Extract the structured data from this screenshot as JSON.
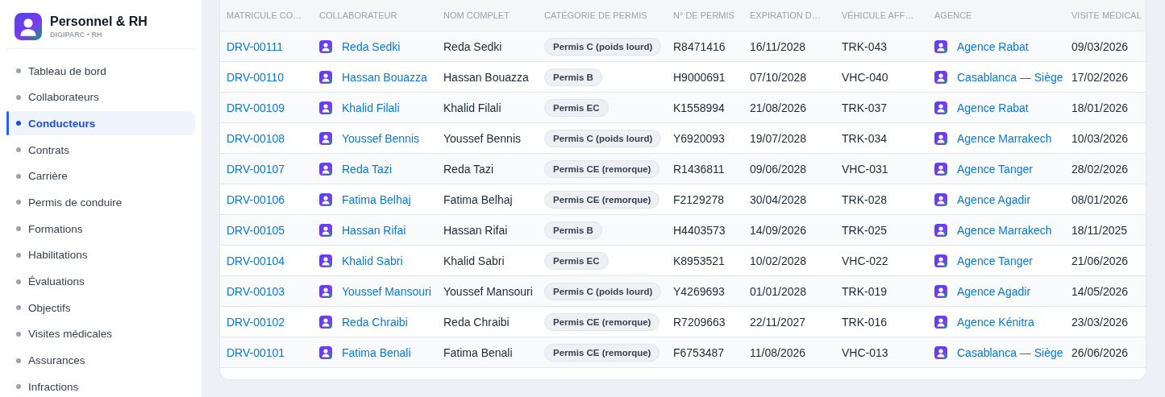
{
  "sidebar": {
    "title": "Personnel & RH",
    "subtitle": "DIGIPARC • RH",
    "items": [
      {
        "label": "Tableau de bord",
        "selected": false
      },
      {
        "label": "Collaborateurs",
        "selected": false
      },
      {
        "label": "Conducteurs",
        "selected": true
      },
      {
        "label": "Contrats",
        "selected": false
      },
      {
        "label": "Carrière",
        "selected": false
      },
      {
        "label": "Permis de conduire",
        "selected": false
      },
      {
        "label": "Formations",
        "selected": false
      },
      {
        "label": "Habilitations",
        "selected": false
      },
      {
        "label": "Évaluations",
        "selected": false
      },
      {
        "label": "Objectifs",
        "selected": false
      },
      {
        "label": "Visites médicales",
        "selected": false
      },
      {
        "label": "Assurances",
        "selected": false
      },
      {
        "label": "Infractions",
        "selected": false
      }
    ]
  },
  "table": {
    "columns": [
      "MATRICULE CO…",
      "COLLABORATEUR",
      "NOM COMPLET",
      "CATÉGORIE DE PERMIS",
      "N° DE PERMIS",
      "EXPIRATION D…",
      "VÉHICULE AFF…",
      "AGENCE",
      "VISITE MÉDICAL"
    ],
    "rows": [
      {
        "matricule": "DRV-00111",
        "collaborateur": "Reda Sedki",
        "nom_complet": "Reda Sedki",
        "categorie": "Permis C (poids lourd)",
        "numero_permis": "R8471416",
        "expiration": "16/11/2028",
        "vehicule": "TRK-043",
        "agence": "Agence Rabat",
        "visite_medicale": "09/03/2026"
      },
      {
        "matricule": "DRV-00110",
        "collaborateur": "Hassan Bouazza",
        "nom_complet": "Hassan Bouazza",
        "categorie": "Permis B",
        "numero_permis": "H9000691",
        "expiration": "07/10/2028",
        "vehicule": "VHC-040",
        "agence": "Casablanca — Siège",
        "visite_medicale": "17/02/2026"
      },
      {
        "matricule": "DRV-00109",
        "collaborateur": "Khalid Filali",
        "nom_complet": "Khalid Filali",
        "categorie": "Permis EC",
        "numero_permis": "K1558994",
        "expiration": "21/08/2026",
        "vehicule": "TRK-037",
        "agence": "Agence Rabat",
        "visite_medicale": "18/01/2026"
      },
      {
        "matricule": "DRV-00108",
        "collaborateur": "Youssef Bennis",
        "nom_complet": "Youssef Bennis",
        "categorie": "Permis C (poids lourd)",
        "numero_permis": "Y6920093",
        "expiration": "19/07/2028",
        "vehicule": "TRK-034",
        "agence": "Agence Marrakech",
        "visite_medicale": "10/03/2026"
      },
      {
        "matricule": "DRV-00107",
        "collaborateur": "Reda Tazi",
        "nom_complet": "Reda Tazi",
        "categorie": "Permis CE (remorque)",
        "numero_permis": "R1436811",
        "expiration": "09/06/2028",
        "vehicule": "VHC-031",
        "agence": "Agence Tanger",
        "visite_medicale": "28/02/2026"
      },
      {
        "matricule": "DRV-00106",
        "collaborateur": "Fatima Belhaj",
        "nom_complet": "Fatima Belhaj",
        "categorie": "Permis CE (remorque)",
        "numero_permis": "F2129278",
        "expiration": "30/04/2028",
        "vehicule": "TRK-028",
        "agence": "Agence Agadir",
        "visite_medicale": "08/01/2026"
      },
      {
        "matricule": "DRV-00105",
        "collaborateur": "Hassan Rifai",
        "nom_complet": "Hassan Rifai",
        "categorie": "Permis B",
        "numero_permis": "H4403573",
        "expiration": "14/09/2026",
        "vehicule": "TRK-025",
        "agence": "Agence Marrakech",
        "visite_medicale": "18/11/2025"
      },
      {
        "matricule": "DRV-00104",
        "collaborateur": "Khalid Sabri",
        "nom_complet": "Khalid Sabri",
        "categorie": "Permis EC",
        "numero_permis": "K8953521",
        "expiration": "10/02/2028",
        "vehicule": "VHC-022",
        "agence": "Agence Tanger",
        "visite_medicale": "21/06/2026"
      },
      {
        "matricule": "DRV-00103",
        "collaborateur": "Youssef Mansouri",
        "nom_complet": "Youssef Mansouri",
        "categorie": "Permis C (poids lourd)",
        "numero_permis": "Y4269693",
        "expiration": "01/01/2028",
        "vehicule": "TRK-019",
        "agence": "Agence Agadir",
        "visite_medicale": "14/05/2026"
      },
      {
        "matricule": "DRV-00102",
        "collaborateur": "Reda Chraibi",
        "nom_complet": "Reda Chraibi",
        "categorie": "Permis CE (remorque)",
        "numero_permis": "R7209663",
        "expiration": "22/11/2027",
        "vehicule": "TRK-016",
        "agence": "Agence Kénitra",
        "visite_medicale": "23/03/2026"
      },
      {
        "matricule": "DRV-00101",
        "collaborateur": "Fatima Benali",
        "nom_complet": "Fatima Benali",
        "categorie": "Permis CE (remorque)",
        "numero_permis": "F6753487",
        "expiration": "11/08/2026",
        "vehicule": "VHC-013",
        "agence": "Casablanca — Siège",
        "visite_medicale": "26/06/2026"
      }
    ]
  }
}
